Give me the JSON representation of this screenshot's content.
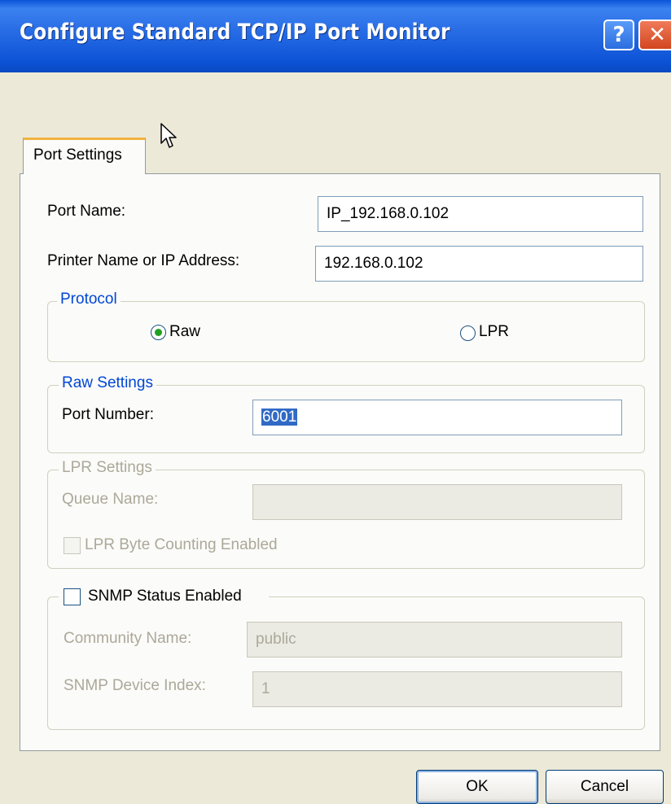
{
  "dialog": {
    "title": "Configure Standard TCP/IP Port Monitor",
    "help_glyph": "?",
    "close_glyph": "✕",
    "tab_label": "Port Settings"
  },
  "fields": {
    "port_name": {
      "label": "Port Name:",
      "value": "IP_192.168.0.102"
    },
    "printer_name": {
      "label": "Printer Name or IP Address:",
      "value": "192.168.0.102"
    }
  },
  "protocol": {
    "legend": "Protocol",
    "options": [
      {
        "label": "Raw",
        "selected": true
      },
      {
        "label": "LPR",
        "selected": false
      }
    ]
  },
  "raw_settings": {
    "legend": "Raw Settings",
    "port_number_label": "Port Number:",
    "port_number_value": "6001"
  },
  "lpr_settings": {
    "legend": "LPR Settings",
    "queue_name_label": "Queue Name:",
    "queue_name_value": "",
    "byte_counting_label": "LPR Byte Counting Enabled",
    "byte_counting_checked": false
  },
  "snmp": {
    "label": "SNMP Status Enabled",
    "checked": false,
    "community_name_label": "Community Name:",
    "community_name_value": "public",
    "device_index_label": "SNMP Device Index:",
    "device_index_value": "1"
  },
  "buttons": {
    "ok": "OK",
    "cancel": "Cancel"
  },
  "colors": {
    "titlebar": "#0a55d8",
    "group_legend": "#0046d5",
    "selection": "#316ac5",
    "radio_dot": "#21a121"
  }
}
